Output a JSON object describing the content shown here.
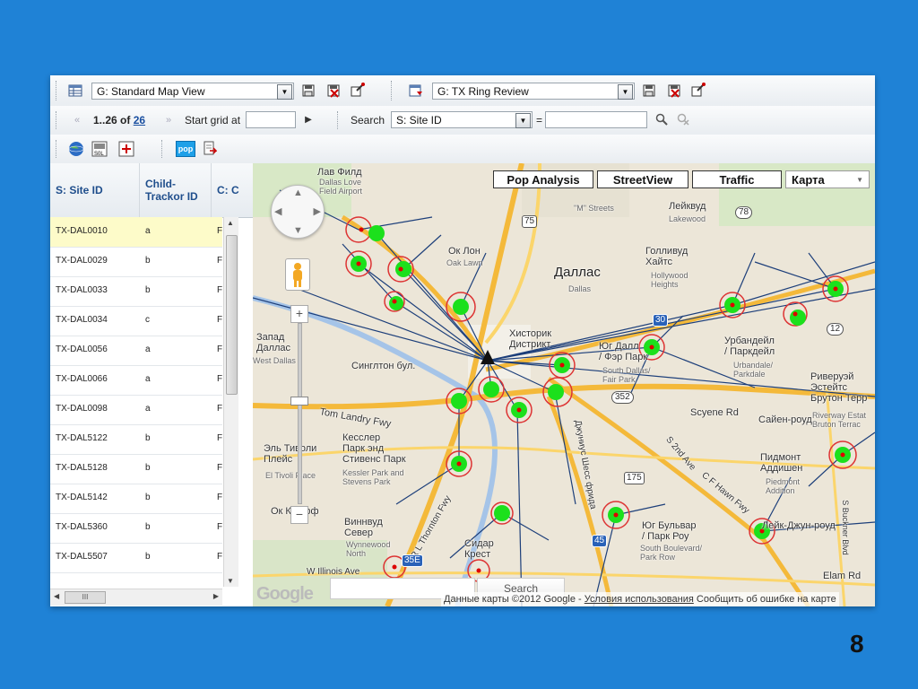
{
  "toolbar1": {
    "view_select": "G: Standard Map View",
    "report_select": "G: TX Ring Review"
  },
  "toolbar2": {
    "range": "1..26",
    "of_label": "of",
    "total": "26",
    "start_grid_label": "Start grid at",
    "search_label": "Search",
    "search_field_select": "S: Site ID",
    "equals": "="
  },
  "toolbar3": {
    "pop_button": "pop",
    "sol_label": "S0L"
  },
  "grid": {
    "columns": [
      "S: Site ID",
      "Child-\nTrackor ID",
      "C: C"
    ],
    "rows": [
      {
        "site": "TX-DAL0010",
        "child": "a",
        "c": "F"
      },
      {
        "site": "TX-DAL0029",
        "child": "b",
        "c": "F"
      },
      {
        "site": "TX-DAL0033",
        "child": "b",
        "c": "F"
      },
      {
        "site": "TX-DAL0034",
        "child": "c",
        "c": "F"
      },
      {
        "site": "TX-DAL0056",
        "child": "a",
        "c": "F"
      },
      {
        "site": "TX-DAL0066",
        "child": "a",
        "c": "F"
      },
      {
        "site": "TX-DAL0098",
        "child": "a",
        "c": "F"
      },
      {
        "site": "TX-DAL5122",
        "child": "b",
        "c": "F"
      },
      {
        "site": "TX-DAL5128",
        "child": "b",
        "c": "F"
      },
      {
        "site": "TX-DAL5142",
        "child": "b",
        "c": "F"
      },
      {
        "site": "TX-DAL5360",
        "child": "b",
        "c": "F"
      },
      {
        "site": "TX-DAL5507",
        "child": "b",
        "c": "F"
      }
    ],
    "hscroll_label": "III"
  },
  "map": {
    "buttons": {
      "pop_analysis": "Pop Analysis",
      "street_view": "StreetView",
      "traffic": "Traffic",
      "map_type": "Карта"
    },
    "labels": {
      "dallas": "Даллас",
      "dallas_en": "Dallas",
      "lav_field": "Лав Филд",
      "lav_field_en": "Dallas Love\nField Airport",
      "ok_lawn": "Ок Лон",
      "ok_lawn_en": "Oak Lawn",
      "leykvud": "Лейквуд",
      "lakewood": "Lakewood",
      "hollywood": "Голливуд\nХайтс",
      "hollywood_en": "Hollywood\nHeights",
      "m_streets": "\"M\" Streets",
      "historic": "Хисторик\nДистрикт",
      "south_dallas": "Юг Далл\n/ Фэр Парк",
      "south_dallas_en": "South Dallas/\nFair Park",
      "urbandale": "Урбандейл\n/ Паркдейл",
      "urbandale_en": "Urbandale/\nParkdale",
      "west_dallas": "Запад\nДаллас",
      "west_dallas_en": "West Dallas",
      "singleton": "Синглтон бул.",
      "tom_landry": "Tom Landry Fwy",
      "kessler": "Кесслер\nПарк энд\nСтивенс Парк",
      "kessler_en": "Kessler Park and\nStevens Park",
      "el_tivoli": "Эль Тиволи\nПлейс",
      "el_tivoli_en": "El Tivoli Place",
      "oak_cliff": "Ок Клифф",
      "wynnewood": "Виннвуд\nСевер",
      "wynnewood_en": "Wynnewood\nNorth",
      "cedar_crest": "Сидар\nКрест",
      "piedmont": "Пидмонт\nАддишен",
      "piedmont_en": "Piedmont\nAddition",
      "south_blvd": "Юг Бульвар\n/ Парк Роу",
      "south_blvd_en": "South Boulevard/\nPark Row",
      "riverway": "Риверуэй\nЭстейтс\nБрутон Терр",
      "riverway_en": "Riverway Estat\nBruton Terrac",
      "scyene": "Scyene Rd",
      "scyene_ru": "Сайен-роуд",
      "elam": "Elam Rd",
      "lake_june": "Лейк-Джун-роуд",
      "sbuckner": "S Buckner Blvd",
      "cf_hawn": "C F Hawn Fwy",
      "second_ave": "S 2nd Ave",
      "rl_thornton": "R L Thornton Fwy",
      "w_illinois": "W Illinois Ave",
      "shields": "Джуниус Шесс фрида",
      "hwy75": "75",
      "hwy78": "78",
      "hwy12": "12",
      "hwy352": "352",
      "hwy175": "175",
      "hwy45": "45",
      "hwy30": "30",
      "hwy35e": "35E"
    },
    "search_button": "Search",
    "copyright": "Данные карты ©2012 Google -",
    "terms_link": "Условия использования",
    "report_error": "Сообщить об ошибке на карте",
    "google_logo": "Google"
  },
  "page_number": "8"
}
